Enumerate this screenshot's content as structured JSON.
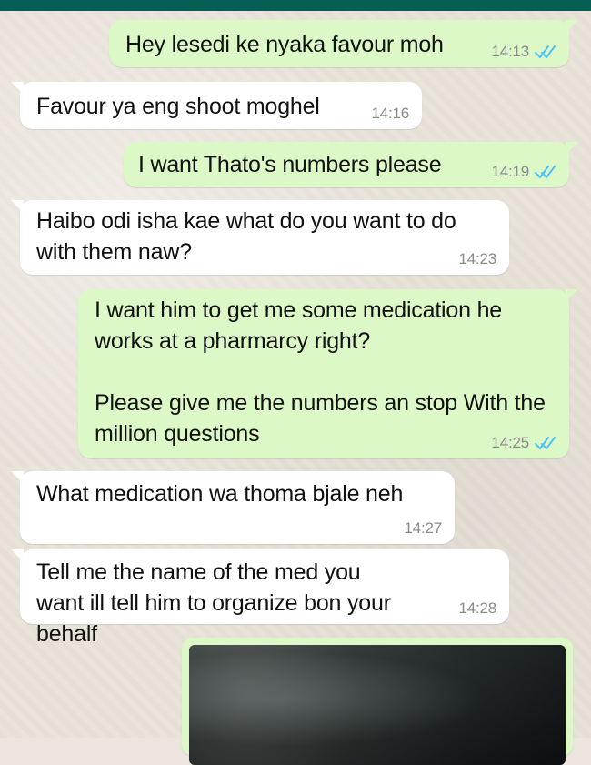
{
  "conversation": {
    "messages": [
      {
        "direction": "outgoing",
        "text": "Hey lesedi ke nyaka favour moh",
        "time": "14:13",
        "status_icon": "read-double-check-icon"
      },
      {
        "direction": "incoming",
        "text": "Favour ya eng shoot moghel",
        "time": "14:16"
      },
      {
        "direction": "outgoing",
        "text": "I want Thato's numbers please",
        "time": "14:19",
        "status_icon": "read-double-check-icon"
      },
      {
        "direction": "incoming",
        "text": "Haibo odi isha kae what do you want to do with them naw?",
        "time": "14:23"
      },
      {
        "direction": "outgoing",
        "text": "I want him to get me some medication he works at a pharmarcy right?\n\nPlease give me the numbers an stop With the million questions",
        "time": "14:25",
        "status_icon": "read-double-check-icon"
      },
      {
        "direction": "incoming",
        "text": "What medication wa thoma bjale neh",
        "time": "14:27"
      },
      {
        "direction": "incoming",
        "text": "Tell me the name of the med you want ill tell him to organize bon your behalf",
        "time": "14:28"
      }
    ],
    "media_preview": {
      "direction": "outgoing",
      "type": "image"
    }
  },
  "colors": {
    "header": "#075e54",
    "outgoing_bubble": "#dcf8c6",
    "incoming_bubble": "#ffffff",
    "time_text": "#8a8a8a",
    "read_check": "#4fc3f7",
    "chat_background": "#ece5dd"
  }
}
